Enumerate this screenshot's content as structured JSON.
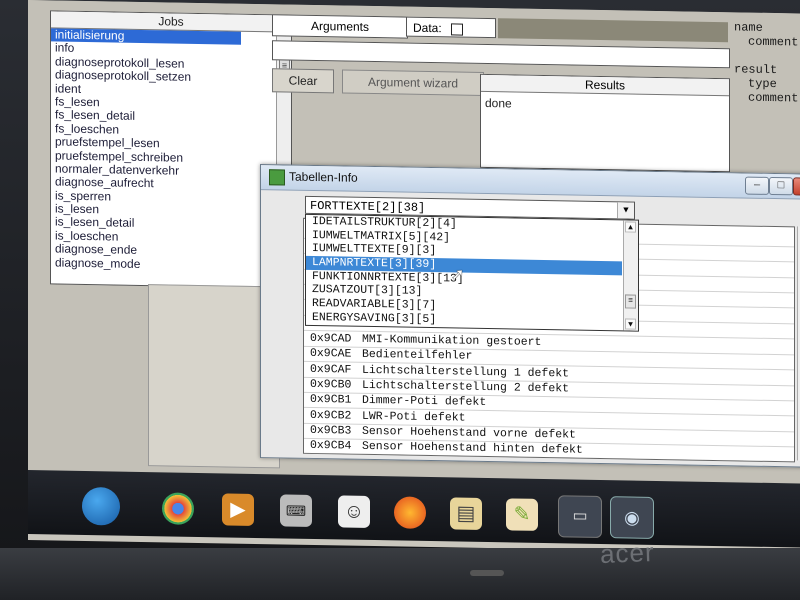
{
  "jobs": {
    "header": "Jobs",
    "items": [
      "initialisierung",
      "info",
      "diagnoseprotokoll_lesen",
      "diagnoseprotokoll_setzen",
      "ident",
      "fs_lesen",
      "fs_lesen_detail",
      "fs_loeschen",
      "pruefstempel_lesen",
      "pruefstempel_schreiben",
      "normaler_datenverkehr",
      "diagnose_aufrecht",
      "is_sperren",
      "is_lesen",
      "is_lesen_detail",
      "is_loeschen",
      "diagnose_ende",
      "diagnose_mode"
    ],
    "selected_index": 0
  },
  "arguments": {
    "label": "Arguments",
    "data_label": "Data:",
    "data_checked": false,
    "value": ""
  },
  "buttons": {
    "clear": "Clear",
    "wizard": "Argument wizard"
  },
  "results": {
    "header": "Results",
    "value": "done"
  },
  "right_panel": {
    "lines": [
      "name",
      "comment",
      "",
      "result",
      "type",
      "comment"
    ]
  },
  "dialog": {
    "title": "Tabellen-Info",
    "combo_value": "FORTTEXTE[2][38]",
    "dropdown_items": [
      "IDETAILSTRUKTUR[2][4]",
      "IUMWELTMATRIX[5][42]",
      "IUMWELTTEXTE[9][3]",
      "LAMPNRTEXTE[3][39]",
      "FUNKTIONNRTEXTE[3][13]",
      "ZUSATZOUT[3][13]",
      "READVARIABLE[3][7]",
      "ENERGYSAVING[3][5]"
    ],
    "dropdown_selected_index": 3,
    "rows": [
      {
        "code": "0x9CAD",
        "text": "MMI-Kommunikation gestoert"
      },
      {
        "code": "0x9CAE",
        "text": "Bedienteilfehler"
      },
      {
        "code": "0x9CAF",
        "text": "Lichtschalterstellung 1 defekt"
      },
      {
        "code": "0x9CB0",
        "text": "Lichtschalterstellung 2 defekt"
      },
      {
        "code": "0x9CB1",
        "text": "Dimmer-Poti defekt"
      },
      {
        "code": "0x9CB2",
        "text": "LWR-Poti defekt"
      },
      {
        "code": "0x9CB3",
        "text": "Sensor Hoehenstand vorne defekt"
      },
      {
        "code": "0x9CB4",
        "text": "Sensor Hoehenstand hinten defekt"
      }
    ],
    "window_buttons": {
      "minimize": "–",
      "maximize": "□",
      "close": "✕"
    }
  },
  "taskbar": {
    "icons": [
      "start-button",
      "chrome-icon",
      "media-icon",
      "keyboard-icon",
      "person-icon",
      "firefox-icon",
      "notes-icon",
      "paint-icon",
      "folder-icon",
      "eye-icon"
    ]
  },
  "device": {
    "brand": "acer"
  },
  "colors": {
    "selection": "#2d6ad6",
    "dropdown_selection": "#3d88d6",
    "app_background": "#c3c0b7"
  }
}
